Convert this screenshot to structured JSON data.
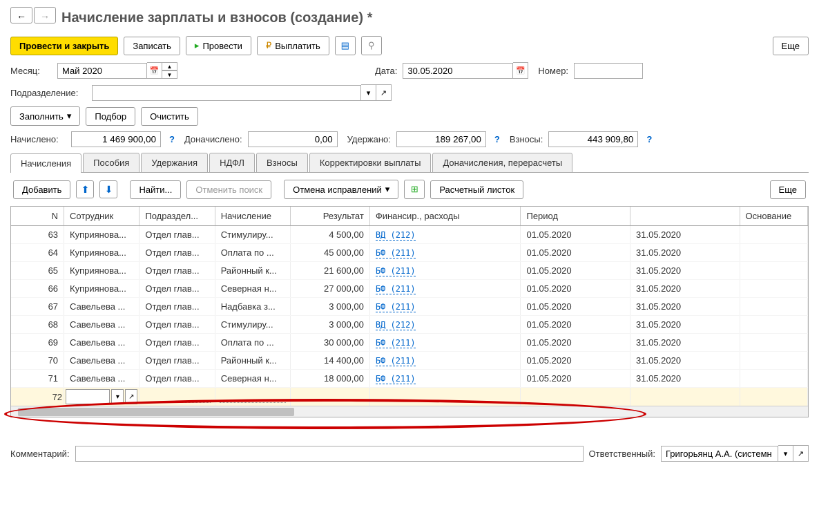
{
  "nav": {
    "back": "←",
    "forward": "→"
  },
  "title": "Начисление зарплаты и взносов (создание) *",
  "toolbar": {
    "post_close": "Провести и закрыть",
    "save": "Записать",
    "post": "Провести",
    "pay": "Выплатить",
    "more": "Еще"
  },
  "form": {
    "month_label": "Месяц:",
    "month_value": "Май 2020",
    "date_label": "Дата:",
    "date_value": "30.05.2020",
    "number_label": "Номер:",
    "number_value": "",
    "dept_label": "Подразделение:",
    "dept_value": ""
  },
  "actions": {
    "fill": "Заполнить",
    "pick": "Подбор",
    "clear": "Очистить"
  },
  "totals": {
    "accrued_label": "Начислено:",
    "accrued": "1 469 900,00",
    "extra_label": "Доначислено:",
    "extra": "0,00",
    "withheld_label": "Удержано:",
    "withheld": "189 267,00",
    "contrib_label": "Взносы:",
    "contrib": "443 909,80"
  },
  "tabs": [
    "Начисления",
    "Пособия",
    "Удержания",
    "НДФЛ",
    "Взносы",
    "Корректировки выплаты",
    "Доначисления, перерасчеты"
  ],
  "table_toolbar": {
    "add": "Добавить",
    "find": "Найти...",
    "cancel_search": "Отменить поиск",
    "cancel_fix": "Отмена исправлений",
    "payslip": "Расчетный листок",
    "more": "Еще"
  },
  "columns": [
    "N",
    "Сотрудник",
    "Подраздел...",
    "Начисление",
    "Результат",
    "Финансир., расходы",
    "Период",
    "",
    "Основание"
  ],
  "rows": [
    {
      "n": "63",
      "emp": "Куприянова...",
      "dep": "Отдел глав...",
      "acc": "Стимулиру...",
      "res": "4 500,00",
      "fin": "ВД (212)",
      "p1": "01.05.2020",
      "p2": "31.05.2020"
    },
    {
      "n": "64",
      "emp": "Куприянова...",
      "dep": "Отдел глав...",
      "acc": "Оплата по ...",
      "res": "45 000,00",
      "fin": "БФ (211)",
      "p1": "01.05.2020",
      "p2": "31.05.2020"
    },
    {
      "n": "65",
      "emp": "Куприянова...",
      "dep": "Отдел глав...",
      "acc": "Районный к...",
      "res": "21 600,00",
      "fin": "БФ (211)",
      "p1": "01.05.2020",
      "p2": "31.05.2020"
    },
    {
      "n": "66",
      "emp": "Куприянова...",
      "dep": "Отдел глав...",
      "acc": "Северная н...",
      "res": "27 000,00",
      "fin": "БФ (211)",
      "p1": "01.05.2020",
      "p2": "31.05.2020"
    },
    {
      "n": "67",
      "emp": "Савельева ...",
      "dep": "Отдел глав...",
      "acc": "Надбавка з...",
      "res": "3 000,00",
      "fin": "БФ (211)",
      "p1": "01.05.2020",
      "p2": "31.05.2020"
    },
    {
      "n": "68",
      "emp": "Савельева ...",
      "dep": "Отдел глав...",
      "acc": "Стимулиру...",
      "res": "3 000,00",
      "fin": "ВД (212)",
      "p1": "01.05.2020",
      "p2": "31.05.2020"
    },
    {
      "n": "69",
      "emp": "Савельева ...",
      "dep": "Отдел глав...",
      "acc": "Оплата по ...",
      "res": "30 000,00",
      "fin": "БФ (211)",
      "p1": "01.05.2020",
      "p2": "31.05.2020"
    },
    {
      "n": "70",
      "emp": "Савельева ...",
      "dep": "Отдел глав...",
      "acc": "Районный к...",
      "res": "14 400,00",
      "fin": "БФ (211)",
      "p1": "01.05.2020",
      "p2": "31.05.2020"
    },
    {
      "n": "71",
      "emp": "Савельева ...",
      "dep": "Отдел глав...",
      "acc": "Северная н...",
      "res": "18 000,00",
      "fin": "БФ (211)",
      "p1": "01.05.2020",
      "p2": "31.05.2020"
    }
  ],
  "edit_row_n": "72",
  "footer": {
    "comment_label": "Комментарий:",
    "comment_value": "",
    "resp_label": "Ответственный:",
    "resp_value": "Григорьянц А.А. (системн"
  }
}
